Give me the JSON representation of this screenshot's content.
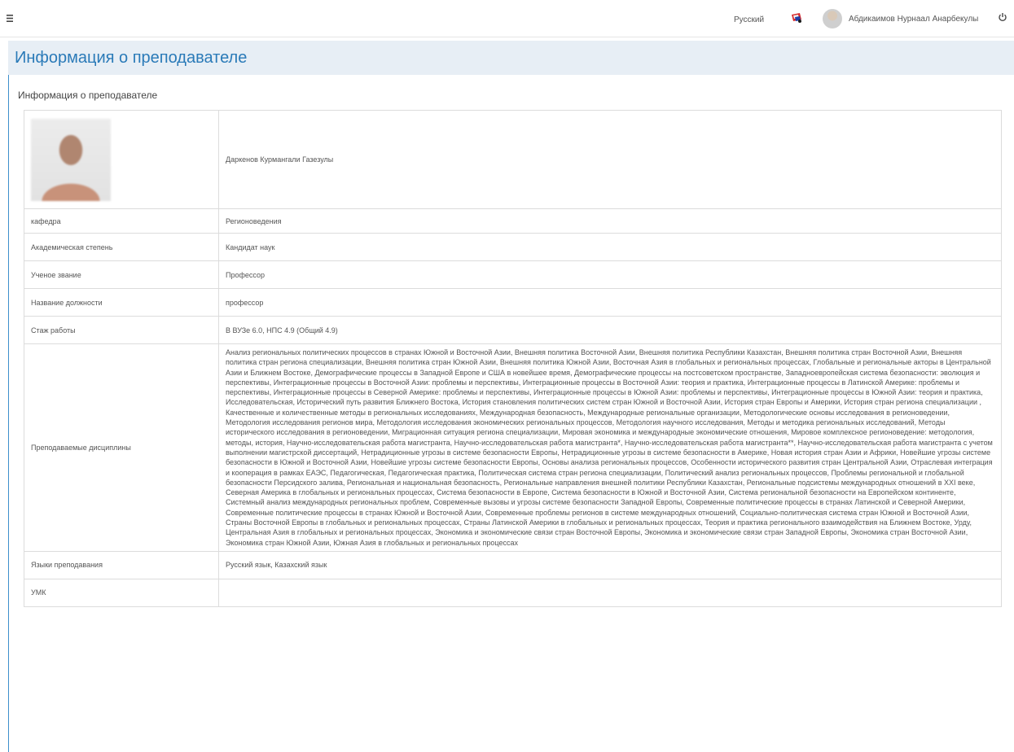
{
  "topbar": {
    "language": "Русский",
    "user_name": "Абдикаимов Нурнаал Анарбекулы"
  },
  "page": {
    "title": "Информация о преподавателе",
    "section_title": "Информация о преподавателе"
  },
  "teacher": {
    "name": "Даркенов Курмангали Газезулы",
    "rows": [
      {
        "label": "кафедра",
        "value": "Регионоведения"
      },
      {
        "label": "Академическая степень",
        "value": "Кандидат наук"
      },
      {
        "label": "Ученое звание",
        "value": "Профессор"
      },
      {
        "label": "Название должности",
        "value": "профессор"
      },
      {
        "label": "Стаж работы",
        "value": "В ВУЗе 6.0, НПС 4.9 (Общий 4.9)"
      }
    ],
    "disciplines_label": "Преподаваемые дисциплины",
    "disciplines": "Анализ региональных политических процессов в странах Южной и Восточной Азии, Внешняя политика Восточной Азии, Внешняя политика Республики Казахстан, Внешняя политика стран Восточной Азии, Внешняя политика стран региона специализации, Внешняя политика стран Южной Азии, Внешняя политика Южной Азии, Восточная Азия в глобальных и региональных процессах, Глобальные и региональные акторы в Центральной Азии и Ближнем Востоке, Демографические процессы в Западной Европе и США в новейшее время, Демографические процессы на постсоветском пространстве, Западноевропейская система безопасности: эволюция и перспективы, Интеграционные процессы в Восточной Азии: проблемы и перспективы, Интеграционные процессы в Восточной Азии: теория и практика, Интеграционные процессы в Латинской Америке: проблемы и перспективы, Интеграционные процессы в Северной Америке: проблемы и перспективы, Интеграционные процессы в Южной Азии: проблемы и перспективы, Интеграционные процессы в Южной Азии: теория и практика, Исследовательская, Исторический путь развития Ближнего Востока, История становления политических систем стран Южной и Восточной Азии, История стран Европы и Америки, История стран региона специализации , Качественные и количественные методы в региональных исследованиях, Международная безопасность, Международные региональные организации, Методологические основы исследования в регионоведении, Методология исследования регионов мира, Методология исследования экономических региональных процессов, Методология научного исследования, Методы и методика региональных исследований, Методы исторического исследования в регионоведении, Миграционная ситуация региона специализации, Мировая экономика и международные экономические отношения, Мировое комплексное регионоведение: методология, методы, история, Научно-исследовательская работа магистранта, Научно-исследовательская работа магистранта*, Научно-исследовательская работа магистранта**, Научно-исследовательская работа магистранта с учетом выполнении магистрской диссертаций, Нетрадиционные угрозы в системе безопасности Европы, Нетрадиционные угрозы в системе безопасности в Америке, Новая история стран Азии и Африки, Новейшие угрозы системе безопасности в Южной и Восточной Азии, Новейшие угрозы системе безопасности Европы, Основы анализа региональных процессов, Особенности исторического развития стран Центральной Азии, Отраслевая интеграция и кооперация в рамках ЕАЭС, Педагогическая, Педагогическая практика, Политическая система стран региона специализации, Политический анализ региональных процессов, Проблемы региональной и глобальной безопасности Персидского залива, Региональная и национальная безопасность, Региональные направления внешней политики Республики Казахстан, Региональные подсистемы международных отношений в XXI веке, Северная Америка в глобальных и региональных процессах, Система безопасности в Европе, Система безопасности в Южной и Восточной Азии, Система региональной безопасности на Европейском континенте, Системный анализ международных региональных проблем, Современные вызовы и угрозы системе безопасности Западной Европы, Современные политические процессы в странах Латинской и Северной Америки, Современные политические процессы в странах Южной и Восточной Азии, Современные проблемы регионов в системе международных отношений, Социально-политическая система стран Южной и Восточной Азии, Страны Восточной Европы в глобальных и региональных процессах, Страны Латинской Америки в глобальных и региональных процессах, Теория и практика регионального взаимодействия на Ближнем Востоке, Урду, Центральная Азия в глобальных и региональных процессах, Экономика и экономические связи стран Восточной Европы, Экономика и экономические связи стран Западной Европы, Экономика стран Восточной Азии, Экономика стран Южной Азии, Южная Азия в глобальных и региональных процессах",
    "languages_label": "Языки преподавания",
    "languages": "Русский язык, Казахский язык",
    "umk_label": "УМК",
    "umk": ""
  },
  "icons": {
    "menu": "hamburger-icon",
    "flag": "flag-icon",
    "power": "power-icon"
  },
  "colors": {
    "header_bg": "#e7eef5",
    "title_blue": "#2a7ab8",
    "accent_border": "#3d8fcc"
  }
}
